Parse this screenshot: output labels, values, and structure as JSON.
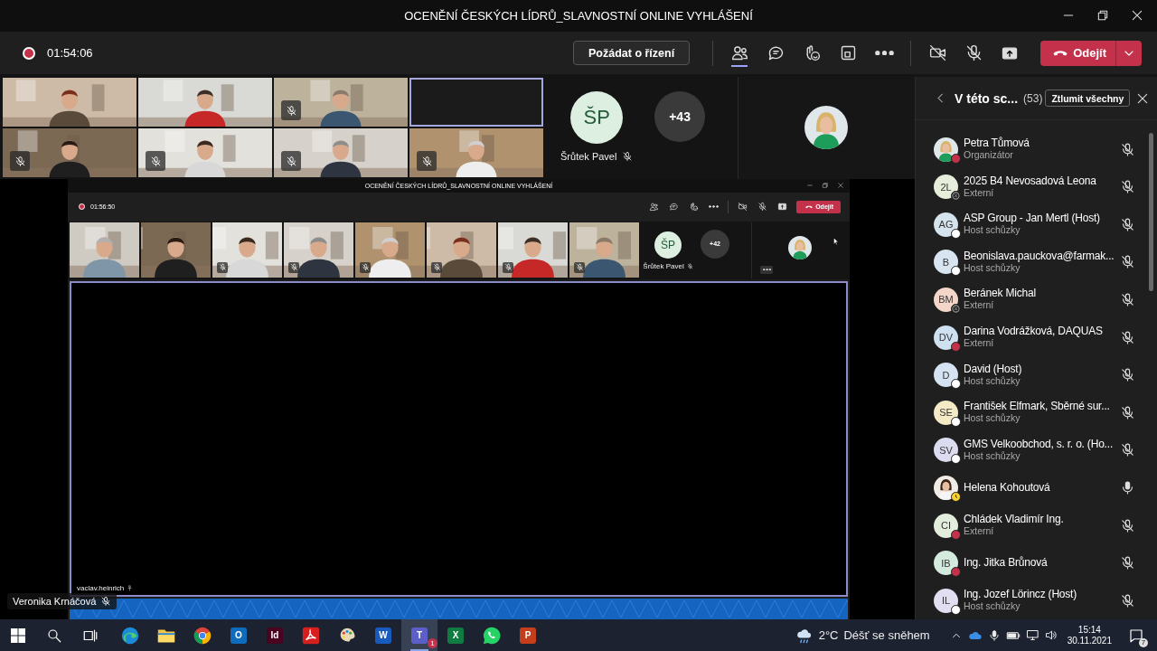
{
  "window": {
    "title": "OCENĚNÍ ČESKÝCH LÍDRŮ_SLAVNOSTNÍ ONLINE VYHLÁŠENÍ"
  },
  "meeting_bar": {
    "recording": true,
    "timer": "01:54:06",
    "request_control": "Požádat o řízení",
    "tools": [
      {
        "kind": "people",
        "selected": true
      },
      {
        "kind": "chat",
        "selected": false
      },
      {
        "kind": "reactions",
        "selected": false
      },
      {
        "kind": "rooms",
        "selected": false
      },
      {
        "kind": "more",
        "selected": false
      }
    ],
    "camera_on": false,
    "mic_on": false,
    "leave": "Odejít"
  },
  "video_strip": {
    "tiles": [
      {
        "kind": "picture",
        "muted": false
      },
      {
        "kind": "picture",
        "muted": false
      },
      {
        "kind": "picture",
        "muted": true
      },
      {
        "kind": "blank",
        "muted": false
      },
      {
        "kind": "picture",
        "muted": true
      },
      {
        "kind": "picture",
        "muted": true
      },
      {
        "kind": "picture",
        "muted": true
      },
      {
        "kind": "picture",
        "muted": true
      }
    ],
    "featured": {
      "initials": "ŠP",
      "name": "Šrůtek Pavel",
      "muted": true
    },
    "overflow": "+43",
    "pinned": {
      "kind": "picture"
    }
  },
  "shared_screen": {
    "title": "OCENĚNÍ ČESKÝCH LÍDRŮ_SLAVNOSTNÍ ONLINE VYHLÁŠENÍ",
    "recording": true,
    "timer": "01:56:50",
    "leave": "Odejít",
    "tiles": [
      {
        "kind": "picture",
        "muted": false
      },
      {
        "kind": "picture",
        "muted": false
      },
      {
        "kind": "picture",
        "muted": true
      },
      {
        "kind": "picture",
        "muted": true
      },
      {
        "kind": "picture",
        "muted": true
      },
      {
        "kind": "picture",
        "muted": true
      },
      {
        "kind": "picture",
        "muted": true
      },
      {
        "kind": "picture",
        "muted": true
      }
    ],
    "featured": {
      "initials": "ŠP",
      "name": "Šrůtek Pavel",
      "muted": true
    },
    "overflow": "+42",
    "presenter": "vaclav.heinrich"
  },
  "presenter_label": {
    "name": "Veronika Krnáčová",
    "muted": true
  },
  "people_panel": {
    "title": "V této sc...",
    "count": "(53)",
    "mute_all": "Ztlumit všechny",
    "participants": [
      {
        "name": "Petra Tůmová",
        "role": "Organizátor",
        "kind": "picture",
        "status": {
          "kind": "busy"
        },
        "muted": true
      },
      {
        "name": "2025 B4 Nevosadová Leona",
        "role": "Externí",
        "kind": "initials",
        "initials": "2L",
        "color": "#e6eedb",
        "status": {
          "kind": "unknown"
        },
        "muted": true
      },
      {
        "name": "ASP Group - Jan Mertl (Host)",
        "role": "Host schůzky",
        "kind": "initials",
        "initials": "AG",
        "color": "#d5e3ec",
        "status": {
          "kind": "offline"
        },
        "muted": true
      },
      {
        "name": "Beonislava.pauckova@farmak...",
        "role": "Host schůzky",
        "kind": "initials",
        "initials": "B",
        "color": "#d8e5f1",
        "status": {
          "kind": "offline"
        },
        "muted": true
      },
      {
        "name": "Beránek Michal",
        "role": "Externí",
        "kind": "initials",
        "initials": "BM",
        "color": "#f4d6c9",
        "status": {
          "kind": "unknown"
        },
        "muted": true
      },
      {
        "name": "Darina Vodrážková, DAQUAS",
        "role": "Externí",
        "kind": "initials",
        "initials": "DV",
        "color": "#cfe0f1",
        "status": {
          "kind": "busy"
        },
        "muted": true
      },
      {
        "name": "David (Host)",
        "role": "Host schůzky",
        "kind": "initials",
        "initials": "D",
        "color": "#d5e2f2",
        "status": {
          "kind": "offline"
        },
        "muted": true
      },
      {
        "name": "František Elfmark, Sběrné sur...",
        "role": "Host schůzky",
        "kind": "initials",
        "initials": "SE",
        "color": "#f5eac6",
        "status": {
          "kind": "offline"
        },
        "muted": true
      },
      {
        "name": "GMS Velkoobchod, s. r. o. (Ho...",
        "role": "Host schůzky",
        "kind": "initials",
        "initials": "SV",
        "color": "#dcdcf0",
        "status": {
          "kind": "offline"
        },
        "muted": true
      },
      {
        "name": "Helena Kohoutová",
        "kind": "picture",
        "status": {
          "kind": "away"
        },
        "muted": false
      },
      {
        "name": "Chládek Vladimír Ing.",
        "role": "Externí",
        "kind": "initials",
        "initials": "CI",
        "color": "#e2eddb",
        "status": {
          "kind": "busy"
        },
        "muted": true
      },
      {
        "name": "Ing. Jitka Brůnová",
        "kind": "initials",
        "initials": "IB",
        "color": "#d3eadf",
        "status": {
          "kind": "busy"
        },
        "muted": true
      },
      {
        "name": "Ing. Jozef Lörincz (Host)",
        "role": "Host schůzky",
        "kind": "initials",
        "initials": "IL",
        "color": "#e0def0",
        "status": {
          "kind": "offline"
        },
        "muted": true
      }
    ]
  },
  "taskbar": {
    "apps": [
      {
        "kind": "start",
        "selected": false
      },
      {
        "kind": "search",
        "selected": false
      },
      {
        "kind": "taskview",
        "selected": false
      },
      {
        "kind": "edge",
        "selected": false
      },
      {
        "kind": "explorer",
        "selected": false
      },
      {
        "kind": "chrome",
        "selected": false
      },
      {
        "kind": "letter",
        "glyph": "O",
        "color": "#0f6cbd",
        "selected": false
      },
      {
        "kind": "letter",
        "glyph": "Id",
        "color": "#49021f",
        "selected": false
      },
      {
        "kind": "acrobat",
        "selected": false
      },
      {
        "kind": "paint",
        "selected": false
      },
      {
        "kind": "letter",
        "glyph": "W",
        "color": "#185abd",
        "selected": false
      },
      {
        "kind": "letter",
        "glyph": "T",
        "color": "#5b5fc7",
        "badge": "1",
        "selected": true
      },
      {
        "kind": "letter",
        "glyph": "X",
        "color": "#107c41",
        "selected": false
      },
      {
        "kind": "whatsapp",
        "selected": false
      },
      {
        "kind": "letter",
        "glyph": "P",
        "color": "#c43e1c",
        "selected": false
      }
    ],
    "weather": {
      "temp": "2°C",
      "text": "Déšť se sněhem"
    },
    "time": "15:14",
    "date": "30.11.2021",
    "notifications": "7"
  }
}
